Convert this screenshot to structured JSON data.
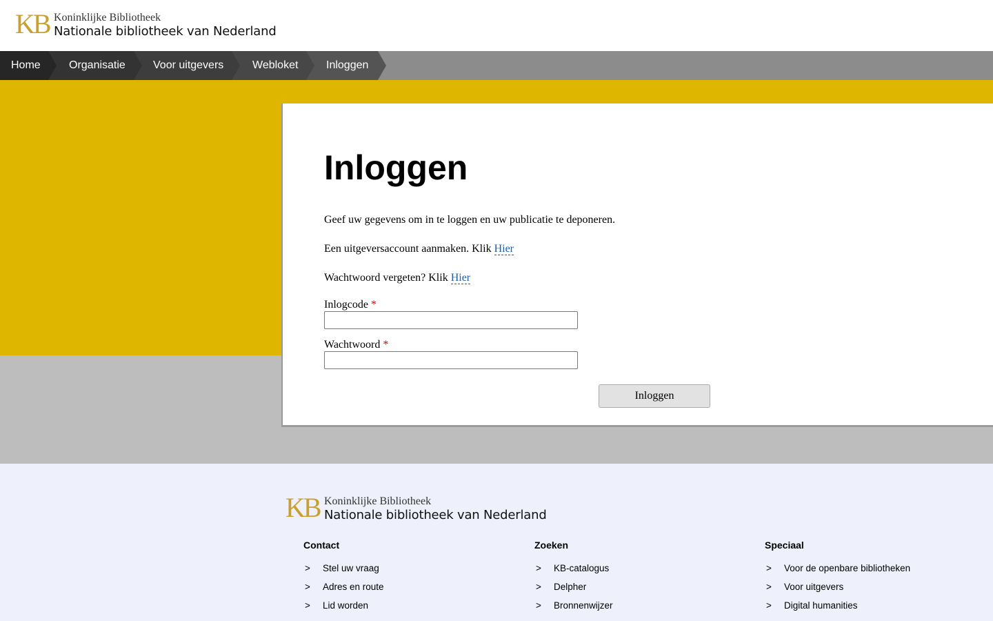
{
  "header": {
    "logo": {
      "mark": "KB",
      "line1": "Koninklijke Bibliotheek",
      "line2": "Nationale bibliotheek van Nederland"
    }
  },
  "nav": {
    "items": [
      {
        "label": "Home"
      },
      {
        "label": "Organisatie"
      },
      {
        "label": "Voor uitgevers"
      },
      {
        "label": "Webloket"
      },
      {
        "label": "Inloggen"
      }
    ]
  },
  "login": {
    "title": "Inloggen",
    "intro": "Geef uw gegevens om in te loggen en uw publicatie te deponeren.",
    "create_account_text": "Een uitgeversaccount aanmaken. Klik ",
    "create_account_link": "Hier",
    "forgot_password_text": "Wachtwoord vergeten? Klik ",
    "forgot_password_link": "Hier",
    "username_label": "Inlogcode",
    "password_label": "Wachtwoord",
    "required_marker": "*",
    "username_value": "",
    "password_value": "",
    "submit_label": "Inloggen"
  },
  "footer": {
    "logo": {
      "mark": "KB",
      "line1": "Koninklijke Bibliotheek",
      "line2": "Nationale bibliotheek van Nederland"
    },
    "arrow": ">",
    "columns": [
      {
        "title": "Contact",
        "links": [
          "Stel uw vraag",
          "Adres en route",
          "Lid worden"
        ]
      },
      {
        "title": "Zoeken",
        "links": [
          "KB-catalogus",
          "Delpher",
          "Bronnenwijzer"
        ]
      },
      {
        "title": "Speciaal",
        "links": [
          "Voor de openbare bibliotheken",
          "Voor uitgevers",
          "Digital humanities"
        ]
      }
    ]
  },
  "colors": {
    "brand_yellow": "#deb600",
    "logo_gold": "#c9a030",
    "nav_bg": "#8c8c8c",
    "link_blue": "#1a5ea8",
    "footer_bg": "#eef0fb"
  }
}
